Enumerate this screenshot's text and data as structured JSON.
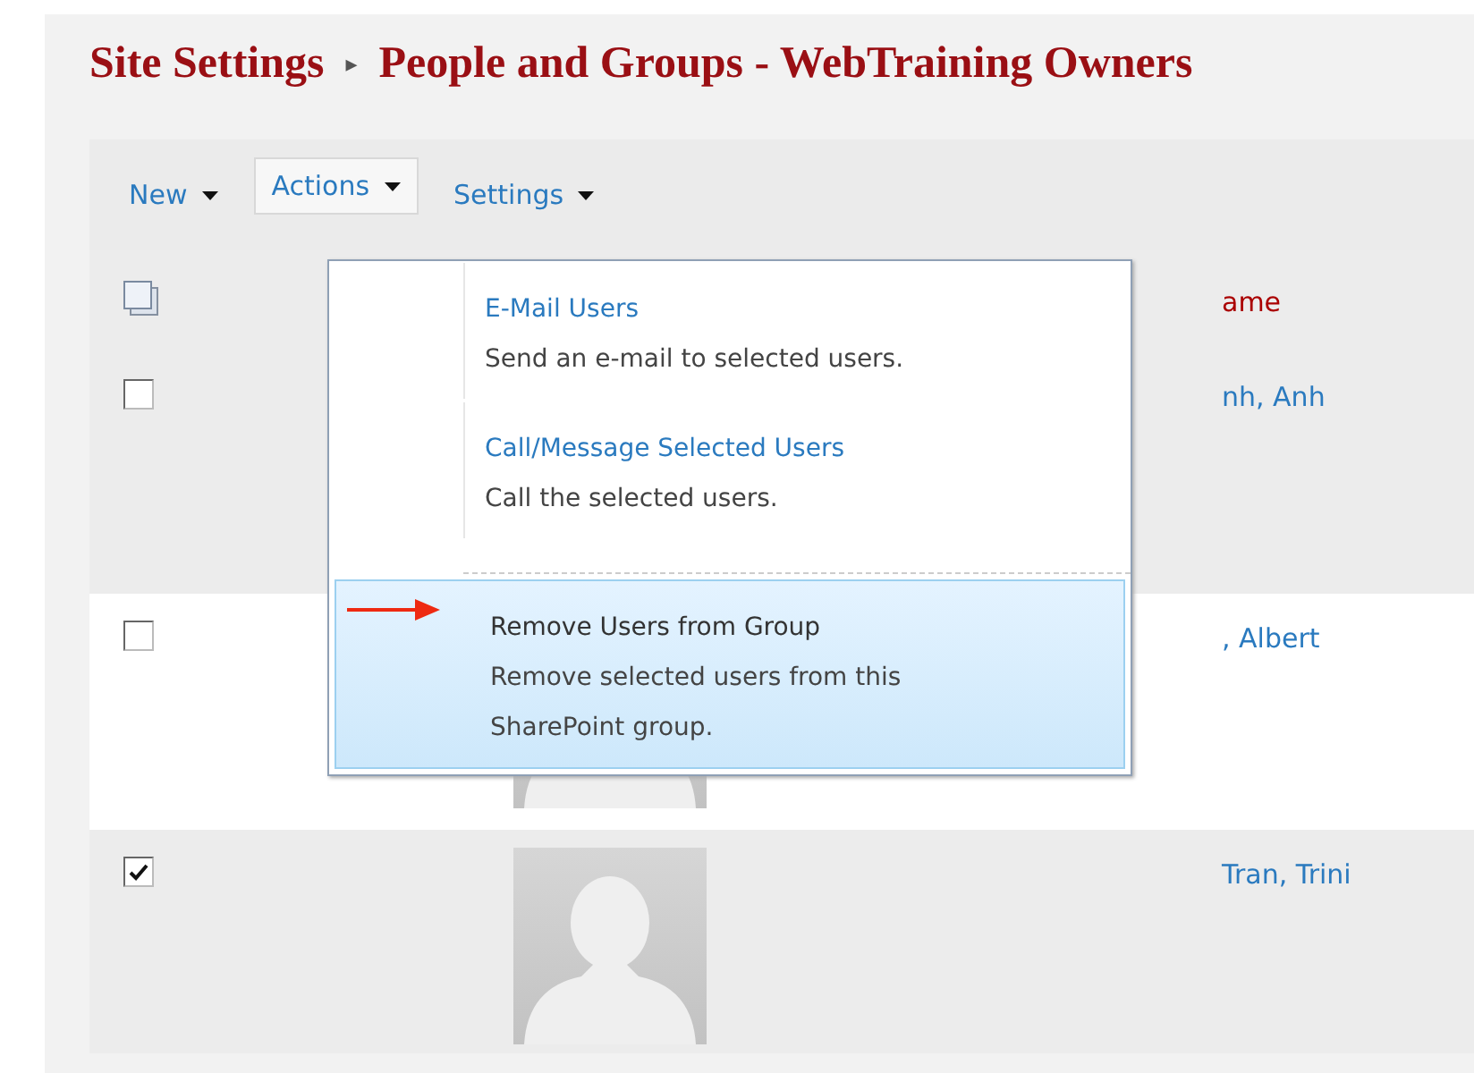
{
  "breadcrumb": {
    "parent": "Site Settings",
    "separator": "▸",
    "current": "People and Groups - WebTraining Owners"
  },
  "toolbar": [
    {
      "label": "New",
      "selected": false
    },
    {
      "label": "Actions",
      "selected": true
    },
    {
      "label": "Settings",
      "selected": false
    }
  ],
  "table": {
    "columns": [
      {
        "kind": "select-all"
      },
      {
        "kind": "picture"
      },
      {
        "kind": "text",
        "label": "ame"
      }
    ],
    "rows": [
      {
        "checked": false,
        "photo": false,
        "name": "nh, Anh"
      },
      {
        "checked": false,
        "photo": true,
        "name": ", Albert"
      },
      {
        "checked": true,
        "photo": true,
        "name": "Tran, Trini"
      }
    ]
  },
  "actions_menu": {
    "items": [
      {
        "title": "E-Mail Users",
        "description": "Send an e-mail to selected users.",
        "selected": false
      },
      {
        "title": "Call/Message Selected Users",
        "description": "Call the selected users.",
        "selected": false
      },
      {
        "title": "Remove Users from Group",
        "description": "Remove selected users from this SharePoint group.",
        "selected": true
      }
    ]
  }
}
